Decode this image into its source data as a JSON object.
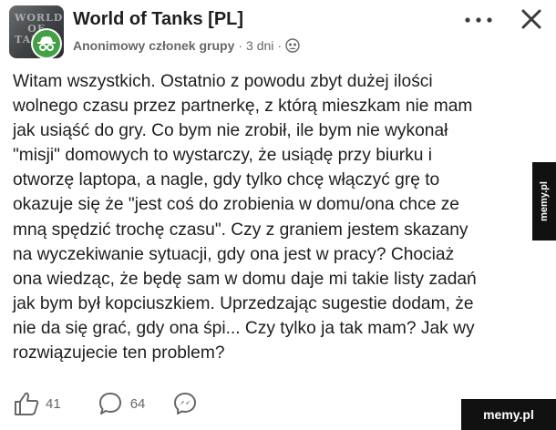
{
  "header": {
    "group_name": "World of Tanks [PL]",
    "author": "Anonimowy członek grupy",
    "separator": "·",
    "time": "3 dni",
    "separator2": "·",
    "avatar_logo": "WORLD OF TANKS",
    "icons": {
      "more": "more-horizontal-icon",
      "close": "close-icon",
      "badge": "anonymous-member-icon",
      "audience": "group-audience-icon"
    }
  },
  "post": {
    "text": "Witam wszystkich. Ostatnio z powodu zbyt dużej ilości\nwolnego czasu przez partnerkę, z którą mieszkam nie mam\njak usiąść do gry. Co bym nie zrobił, ile bym nie wykonał\n\"misji\" domowych to wystarczy, że usiądę przy biurku i\notworzę laptopa, a nagle, gdy tylko chcę włączyć grę to\nokazuje się że \"jest coś do zrobienia w domu/ona chce ze\nmną spędzić trochę czasu\". Czy z graniem jestem skazany\nna wyczekiwanie sytuacji, gdy ona jest w pracy? Chociaż\nona wiedząc, że będę sam w domu daje mi takie listy zadań\njak bym był kopciuszkiem. Uprzedzając sugestie dodam, że\nnie da się grać, gdy ona śpi... Czy tylko ja tak mam? Jak wy\nrozwiązujecie ten problem?"
  },
  "actions": {
    "likes": "41",
    "comments": "64",
    "icons": {
      "like": "thumbs-up-icon",
      "comment": "comment-bubble-icon",
      "share": "messenger-icon"
    }
  },
  "watermarks": {
    "side": "memy.pl",
    "corner": "memy.pl"
  }
}
